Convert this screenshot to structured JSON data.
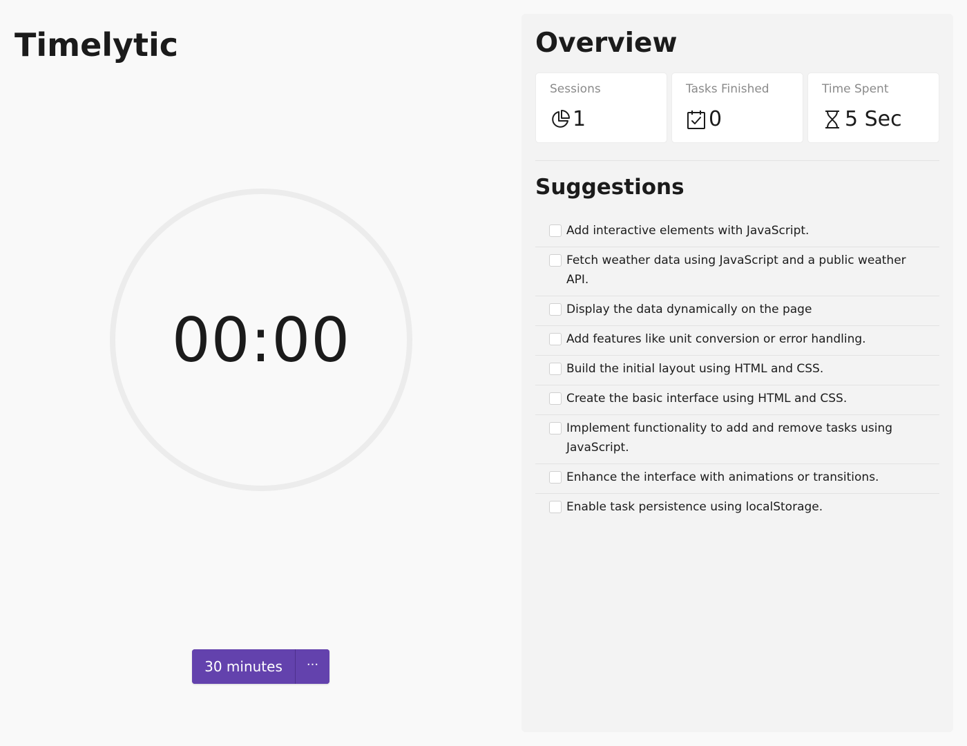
{
  "app": {
    "title": "Timelytic"
  },
  "timer": {
    "display": "00:00"
  },
  "controls": {
    "duration_label": "30 minutes",
    "more_label": "···"
  },
  "overview": {
    "title": "Overview",
    "stats": [
      {
        "label": "Sessions",
        "value": "1",
        "icon": "pie-chart-icon"
      },
      {
        "label": "Tasks Finished",
        "value": "0",
        "icon": "calendar-check-icon"
      },
      {
        "label": "Time Spent",
        "value": "5 Sec",
        "icon": "hourglass-icon"
      }
    ]
  },
  "suggestions": {
    "title": "Suggestions",
    "items": [
      {
        "text": "Add interactive elements with JavaScript.",
        "checked": false
      },
      {
        "text": "Fetch weather data using JavaScript and a public weather API.",
        "checked": false
      },
      {
        "text": "Display the data dynamically on the page",
        "checked": false
      },
      {
        "text": "Add features like unit conversion or error handling.",
        "checked": false
      },
      {
        "text": "Build the initial layout using HTML and CSS.",
        "checked": false
      },
      {
        "text": "Create the basic interface using HTML and CSS.",
        "checked": false
      },
      {
        "text": "Implement functionality to add and remove tasks using JavaScript.",
        "checked": false
      },
      {
        "text": "Enhance the interface with animations or transitions.",
        "checked": false
      },
      {
        "text": "Enable task persistence using localStorage.",
        "checked": false
      }
    ]
  },
  "colors": {
    "accent": "#6342ad",
    "page_background": "#f9f9f9",
    "panel_background": "#f3f3f3",
    "ring": "#ececec"
  }
}
